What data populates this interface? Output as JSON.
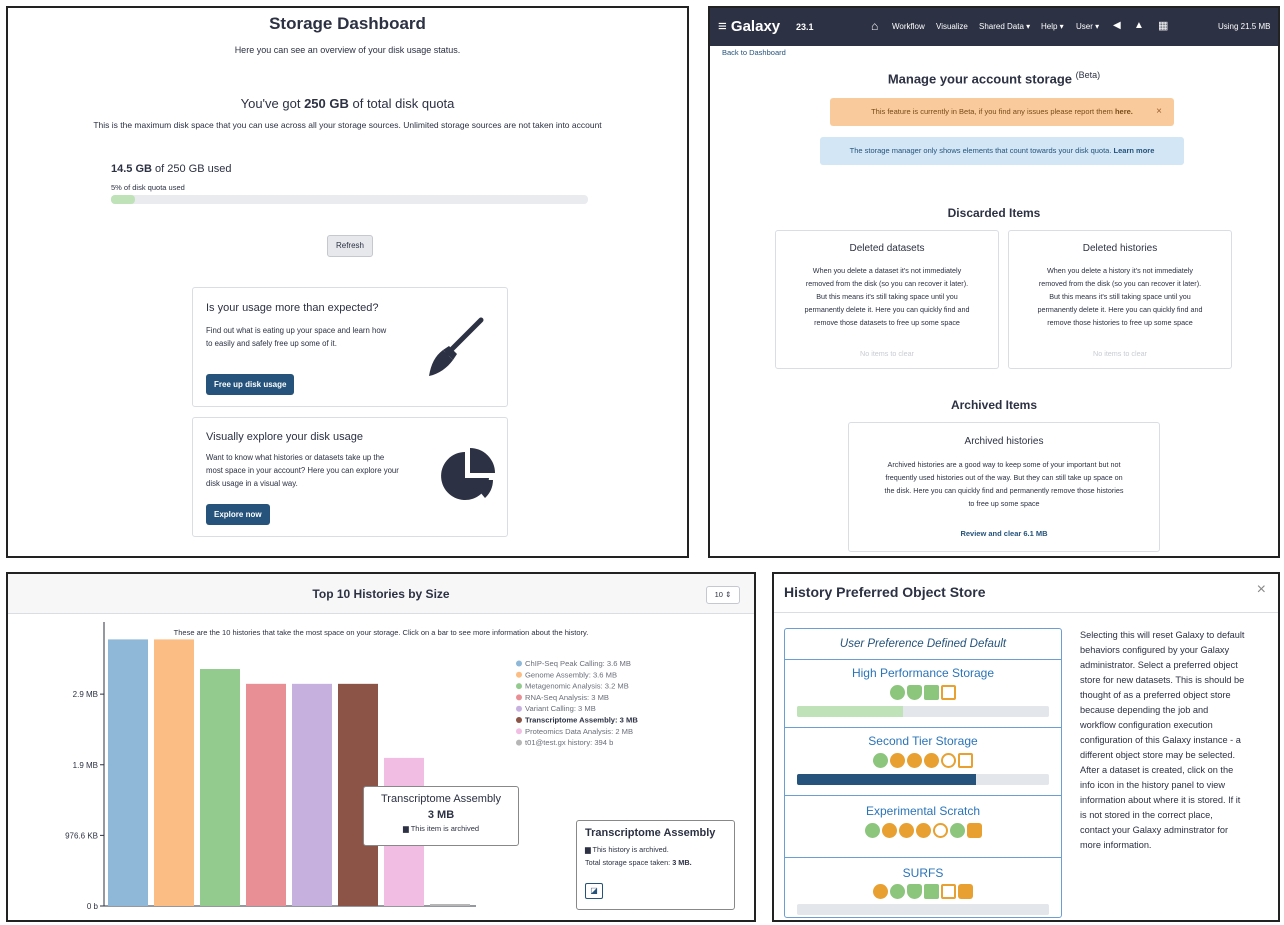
{
  "dashboard": {
    "title": "Storage Dashboard",
    "subtitle": "Here you can see an overview of your disk usage status.",
    "quota_prefix": "You've got ",
    "quota_value": "250 GB",
    "quota_suffix": " of total disk quota",
    "quota_note": "This is the maximum disk space that you can use across all your storage sources. Unlimited storage sources are not taken into account",
    "used_value": "14.5 GB",
    "used_suffix": " of 250 GB used",
    "percent_label": "5% of disk quota used",
    "percent": 5,
    "refresh_label": "Refresh",
    "card1_title": "Is your usage more than expected?",
    "card1_text_1": "Find out what is eating up your space and learn how",
    "card1_text_2": "to easily and safely free up some of it.",
    "card1_button": "Free up disk usage",
    "card2_title": "Visually explore your disk usage",
    "card2_text_1": "Want to know what histories or datasets take up the",
    "card2_text_2": "most space in your account? Here you can explore your",
    "card2_text_3": "disk usage in a visual way.",
    "card2_button": "Explore now"
  },
  "manage": {
    "brand": "Galaxy",
    "version": "23.1",
    "nav": [
      "Workflow",
      "Visualize",
      "Shared Data ▾",
      "Help ▾",
      "User ▾"
    ],
    "usage": "Using 21.5 MB",
    "back_link": "Back to Dashboard",
    "title": "Manage your account storage",
    "beta": "(Beta)",
    "beta_alert": "This feature is currently in Beta, if you find any issues please report them",
    "beta_alert_link": "here.",
    "info_alert": "The storage manager only shows elements that count towards your disk quota.",
    "info_alert_link": "Learn more",
    "discarded_heading": "Discarded Items",
    "deleted_datasets_title": "Deleted datasets",
    "deleted_datasets_lines": [
      "When you delete a dataset it's not immediately",
      "removed from the disk (so you can recover it later).",
      "But this means it's still taking space until you",
      "permanently delete it. Here you can quickly find and",
      "remove those datasets to free up some space"
    ],
    "deleted_histories_title": "Deleted histories",
    "deleted_histories_lines": [
      "When you delete a history it's not immediately",
      "removed from the disk (so you can recover it later).",
      "But this means it's still taking space until you",
      "permanently delete it. Here you can quickly find and",
      "remove those histories to free up some space"
    ],
    "no_items": "No items to clear",
    "archived_heading": "Archived Items",
    "archived_title": "Archived histories",
    "archived_lines": [
      "Archived histories are a good way to keep some of your important but not",
      "frequently used histories out of the way. But they can still take up space on",
      "the disk. Here you can quickly find and permanently remove those histories",
      "to free up some space"
    ],
    "review_link": "Review and clear 6.1 MB"
  },
  "top_histories": {
    "title": "Top 10 Histories by Size",
    "select_value": "10 ⇕",
    "description": "These are the 10 histories that take the most space on your storage. Click on a bar to see more information about the history.",
    "tooltip_name": "Transcriptome Assembly",
    "tooltip_size": "3 MB",
    "tooltip_archived": "This item is archived",
    "info_name": "Transcriptome Assembly",
    "info_archived": "This history is archived.",
    "info_total_prefix": "Total storage space taken: ",
    "info_total_value": "3 MB."
  },
  "chart_data": {
    "type": "bar",
    "title": "Top 10 Histories by Size",
    "categories": [
      "ChIP-Seq Peak Calling",
      "Genome Assembly",
      "Metagenomic Analysis",
      "RNA-Seq Analysis",
      "Variant Calling",
      "Transcriptome Assembly",
      "Proteomics Data Analysis",
      "t01@test.gx history"
    ],
    "values_mb": [
      3.6,
      3.6,
      3.2,
      3.0,
      3.0,
      3.0,
      2.0,
      0.000376
    ],
    "legend_labels": [
      "ChIP-Seq Peak Calling: 3.6 MB",
      "Genome Assembly: 3.6 MB",
      "Metagenomic Analysis: 3.2 MB",
      "RNA-Seq Analysis: 3 MB",
      "Variant Calling: 3 MB",
      "Transcriptome Assembly: 3 MB",
      "Proteomics Data Analysis: 2 MB",
      "t01@test.gx history: 394 b"
    ],
    "colors": [
      "#8fb7d8",
      "#fbbd84",
      "#93cb8f",
      "#e88f95",
      "#c6b1de",
      "#8c5347",
      "#f1bde2",
      "#b6b6b6"
    ],
    "ytick_values": [
      0,
      0.9537,
      1.9073,
      2.861
    ],
    "ytick_labels": [
      "0 b",
      "976.6 KB",
      "1.9 MB",
      "2.9 MB"
    ],
    "ylim": [
      0,
      3.7
    ],
    "legend": "right"
  },
  "object_store": {
    "title": "History Preferred Object Store",
    "close": "×",
    "default_label": "User Preference Defined Default",
    "stores": [
      {
        "name": "High Performance Storage",
        "fill": 0.42,
        "color": "#bfe2b8"
      },
      {
        "name": "Second Tier Storage",
        "fill": 0.71,
        "color": "#25537b"
      },
      {
        "name": "Experimental Scratch",
        "fill": 0,
        "color": "#25537b"
      },
      {
        "name": "SURFS",
        "fill": 0,
        "color": "#25537b"
      }
    ],
    "description": [
      "Selecting this will reset Galaxy to default",
      "behaviors configured by your Galaxy",
      "administrator. Select a preferred object",
      "store for new datasets. This is should be",
      "thought of as a preferred object store",
      "because depending the job and",
      "workflow configuration execution",
      "configuration of this Galaxy instance - a",
      "different object store may be selected.",
      "After a dataset is created, click on the",
      "info icon in the history panel to view",
      "information about where it is stored. If it",
      "is not stored in the correct place,",
      "contact your Galaxy adminstrator for",
      "more information."
    ]
  }
}
